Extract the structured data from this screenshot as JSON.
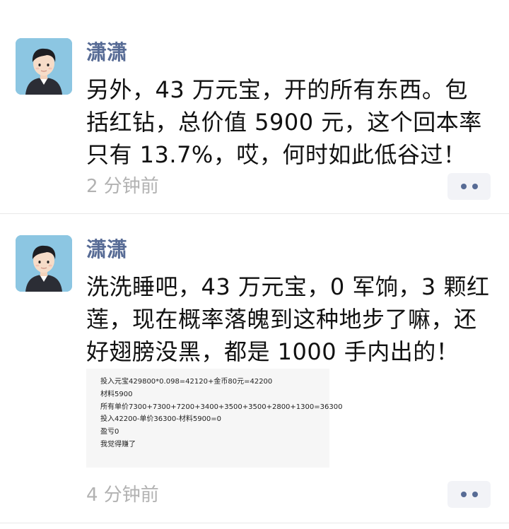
{
  "posts": [
    {
      "author": "潇潇",
      "content_lines": [
        "另外，43 万元宝，开的所有东西。包",
        "括红钻，总价值 5900 元，这个回本率",
        "只有 13.7%，哎，何时如此低谷过！"
      ],
      "time": "2 分钟前",
      "avatar_icon": "avatar-man-icon",
      "more_icon": "more-dots-icon"
    },
    {
      "author": "潇潇",
      "content_lines": [
        "洗洗睡吧，43 万元宝，0 军饷，3 颗红",
        "莲，现在概率落魄到这种地步了嘛，还",
        "好翅膀没黑，都是 1000 手内出的！"
      ],
      "attachment_lines": [
        "投入元宝429800*0.098=42120+金币80元=42200",
        "材料5900",
        "所有单价7300+7300+7200+3400+3500+3500+2800+1300=36300",
        "投入42200-单价36300-材料5900=0",
        "盈亏0",
        "我觉得赚了"
      ],
      "time": "4 分钟前",
      "avatar_icon": "avatar-man-icon",
      "more_icon": "more-dots-icon"
    }
  ],
  "colors": {
    "author": "#576b95",
    "time": "#b2b2b2",
    "avatar_bg": "#8cc6e2",
    "more_btn_bg": "#f2f3f7"
  }
}
